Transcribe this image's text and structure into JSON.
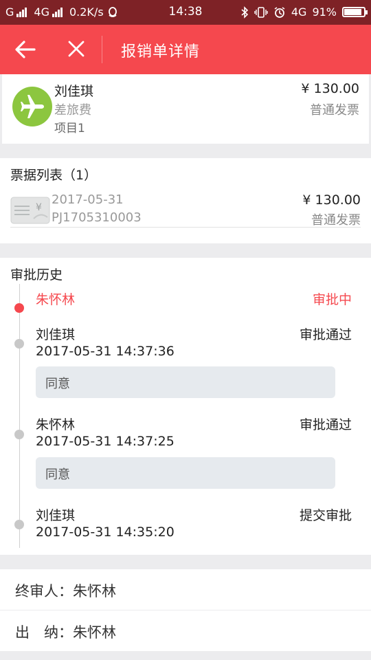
{
  "status_bar": {
    "carrier": "G",
    "network": "4G",
    "speed": "0.2K/s",
    "time": "14:38",
    "network2": "4G",
    "battery": "91%",
    "battery_level": 0.91
  },
  "header": {
    "title": "报销单详情"
  },
  "summary": {
    "name": "刘佳琪",
    "expense_type": "差旅费",
    "project": "项目1",
    "amount": "¥ 130.00",
    "invoice_kind": "普通发票"
  },
  "bills": {
    "heading": "票据列表（1）",
    "items": [
      {
        "date": "2017-05-31",
        "number": "PJ1705310003",
        "amount": "¥ 130.00",
        "kind": "普通发票"
      }
    ]
  },
  "history": {
    "heading": "审批历史",
    "entries": [
      {
        "name": "朱怀林",
        "status": "审批中",
        "time": "",
        "comment": ""
      },
      {
        "name": "刘佳琪",
        "status": "审批通过",
        "time": "2017-05-31 14:37:36",
        "comment": "同意"
      },
      {
        "name": "朱怀林",
        "status": "审批通过",
        "time": "2017-05-31 14:37:25",
        "comment": "同意"
      },
      {
        "name": "刘佳琪",
        "status": "提交审批",
        "time": "2017-05-31 14:35:20",
        "comment": ""
      }
    ]
  },
  "final_approver": "终审人：朱怀林",
  "cashier": "出　纳：朱怀林",
  "colors": {
    "accent": "#f5484e",
    "status_bar": "#7e2226",
    "avatar": "#8cc63f"
  }
}
